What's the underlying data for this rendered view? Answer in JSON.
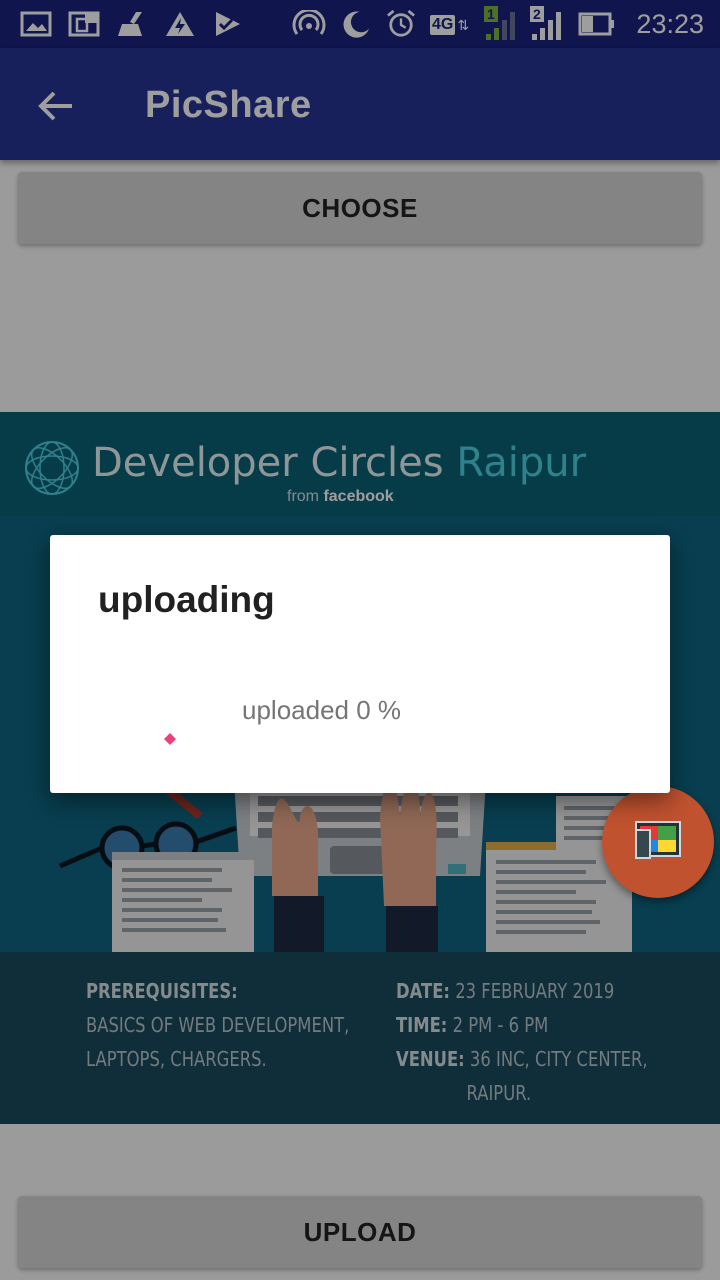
{
  "status_bar": {
    "time": "23:23",
    "network_type": "4G",
    "sim1_label": "1",
    "sim2_label": "2",
    "icons": [
      "gallery-icon",
      "screen-cast-icon",
      "cleaner-icon",
      "flash-app-icon",
      "vpn-check-icon",
      "hotspot-icon",
      "night-mode-icon",
      "alarm-icon",
      "network-4g-icon",
      "signal-sim1-icon",
      "signal-sim2-icon",
      "battery-icon"
    ]
  },
  "app_bar": {
    "title": "PicShare",
    "back_icon": "arrow-back-icon"
  },
  "choose_button": {
    "label": "CHOOSE"
  },
  "upload_button": {
    "label": "UPLOAD"
  },
  "poster": {
    "title_main": "Developer Circles ",
    "title_city": "Raipur",
    "from_text": "from ",
    "from_brand": "facebook",
    "prerequisites_label": "PREREQUISITES:",
    "prerequisites_line1": "BASICS OF WEB DEVELOPMENT,",
    "prerequisites_line2": "LAPTOPS, CHARGERS.",
    "date_label": "DATE:",
    "date_value": " 23 FEBRUARY 2019",
    "time_label": "TIME:",
    "time_value": " 2 PM - 6 PM",
    "venue_label": "VENUE:",
    "venue_line1": " 36 INC, CITY CENTER,",
    "venue_line2": "RAIPUR."
  },
  "fab": {
    "icon": "image-gallery-icon",
    "color": "#c0522f"
  },
  "dialog": {
    "title": "uploading",
    "message": "uploaded 0 %",
    "progress_percent": 0,
    "spinner_color": "#ec407a"
  },
  "colors": {
    "status_bar": "#1a237e",
    "app_bar": "#283593",
    "button": "#d6d6d6"
  }
}
